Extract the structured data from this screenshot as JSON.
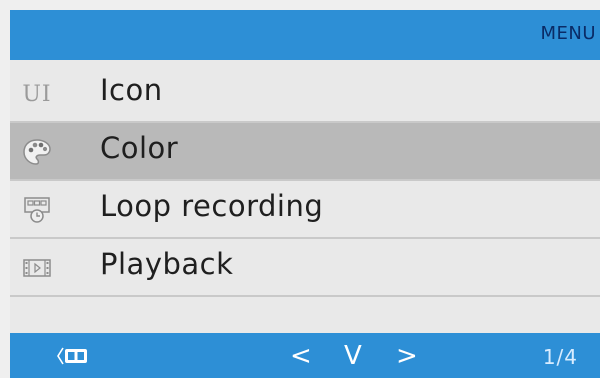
{
  "header": {
    "title": "MENU"
  },
  "menu": {
    "items": [
      {
        "icon": "ui-icon",
        "icon_text": "UI",
        "label": "Icon",
        "selected": false
      },
      {
        "icon": "palette-icon",
        "label": "Color",
        "selected": true
      },
      {
        "icon": "loop-recording-icon",
        "label": "Loop recording",
        "selected": false
      },
      {
        "icon": "playback-film-icon",
        "label": "Playback",
        "selected": false
      }
    ]
  },
  "footer": {
    "back_icon": "back-mode-icon",
    "left_symbol": "<",
    "down_symbol": "V",
    "right_symbol": ">",
    "page": "1/4"
  },
  "colors": {
    "bar_blue": "#2d8fd6",
    "menu_title": "#0a2b66",
    "selected_row": "#b9b9b9",
    "row_bg": "#e9e9e9"
  }
}
